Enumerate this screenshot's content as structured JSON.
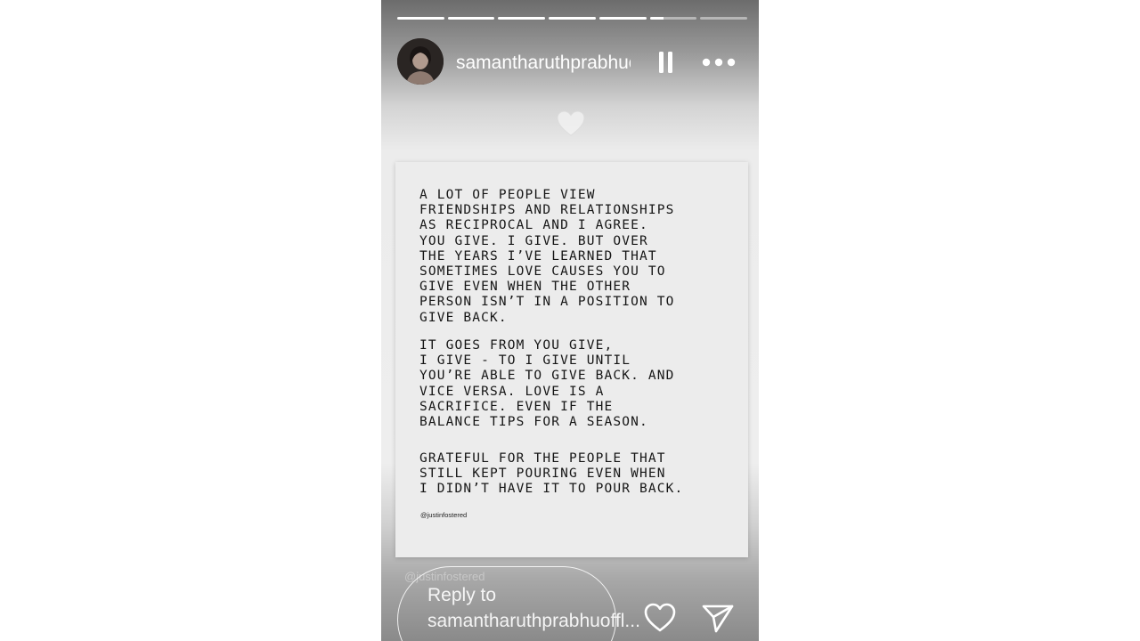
{
  "story": {
    "username": "samantharuthprabhuoffl",
    "progress_segments": [
      1,
      1,
      1,
      1,
      1,
      0.3,
      0
    ],
    "heart_emoji": "white-heart-emoji"
  },
  "card": {
    "paragraphs": [
      "A LOT OF PEOPLE VIEW\nFRIENDSHIPS AND RELATIONSHIPS\nAS RECIPROCAL AND I AGREE.\nYOU GIVE. I GIVE. BUT OVER\nTHE YEARS I’VE LEARNED THAT\nSOMETIMES LOVE CAUSES YOU TO\nGIVE EVEN WHEN THE OTHER\nPERSON ISN’T IN A POSITION TO\nGIVE BACK.",
      "IT GOES FROM YOU GIVE,\nI GIVE - TO I GIVE UNTIL\nYOU’RE ABLE TO GIVE BACK. AND\nVICE VERSA. LOVE IS A\nSACRIFICE. EVEN IF THE\nBALANCE TIPS FOR A SEASON.",
      "GRATEFUL FOR THE PEOPLE THAT\nSTILL KEPT POURING EVEN WHEN\nI DIDN’T HAVE IT TO POUR BACK."
    ],
    "credit": "@justinfostered"
  },
  "overlay_credit": "@justinfostered",
  "footer": {
    "reply_placeholder": "Reply to samantharuthprabhuoffl..."
  },
  "icons": {
    "pause": "pause-icon",
    "more": "more-options-icon",
    "like": "heart-icon",
    "send": "send-icon"
  },
  "colors": {
    "text_on_card": "#161616",
    "card_background": "#ececec",
    "overlay_text": "#ffffff"
  }
}
